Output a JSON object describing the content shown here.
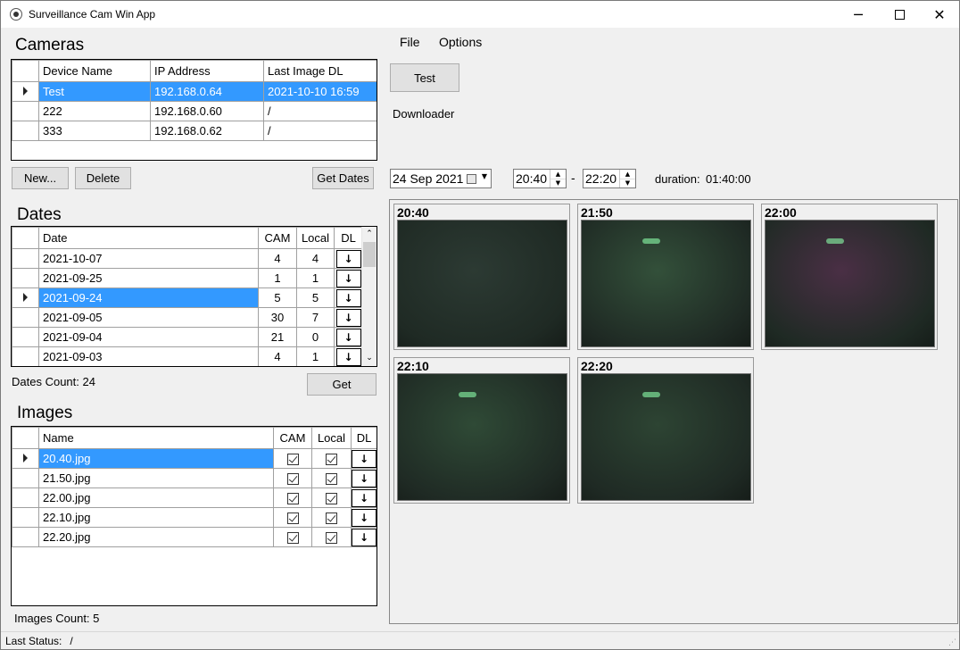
{
  "window": {
    "title": "Surveillance Cam Win App"
  },
  "menu": {
    "file": "File",
    "options": "Options"
  },
  "cameras": {
    "heading": "Cameras",
    "columns": [
      "Device Name",
      "IP Address",
      "Last Image DL"
    ],
    "rows": [
      {
        "name": "Test",
        "ip": "192.168.0.64",
        "last": "2021-10-10 16:59"
      },
      {
        "name": "222",
        "ip": "192.168.0.60",
        "last": "/"
      },
      {
        "name": "333",
        "ip": "192.168.0.62",
        "last": "/"
      }
    ],
    "selected_row": 0,
    "new_label": "New...",
    "delete_label": "Delete",
    "get_dates_label": "Get Dates"
  },
  "dates": {
    "heading": "Dates",
    "columns": [
      "Date",
      "CAM",
      "Local",
      "DL"
    ],
    "rows": [
      {
        "date": "2021-10-07",
        "cam": "4",
        "local": "4"
      },
      {
        "date": "2021-09-25",
        "cam": "1",
        "local": "1"
      },
      {
        "date": "2021-09-24",
        "cam": "5",
        "local": "5"
      },
      {
        "date": "2021-09-05",
        "cam": "30",
        "local": "7"
      },
      {
        "date": "2021-09-04",
        "cam": "21",
        "local": "0"
      },
      {
        "date": "2021-09-03",
        "cam": "4",
        "local": "1"
      }
    ],
    "selected_row": 2,
    "dl_glyph": "↓",
    "count_text": "Dates Count: 24",
    "get_label": "Get"
  },
  "images": {
    "heading": "Images",
    "columns": [
      "Name",
      "CAM",
      "Local",
      "DL"
    ],
    "rows": [
      {
        "name": "20.40.jpg"
      },
      {
        "name": "21.50.jpg"
      },
      {
        "name": "22.00.jpg"
      },
      {
        "name": "22.10.jpg"
      },
      {
        "name": "22.20.jpg"
      }
    ],
    "selected_row": 0,
    "count_text": "Images Count: 5"
  },
  "toolbar": {
    "test_label": "Test",
    "downloader_label": "Downloader"
  },
  "filter": {
    "date": "24 Sep 2021",
    "time_from": "20:40",
    "dash": "-",
    "time_to": "22:20",
    "duration_label": "duration:",
    "duration_value": "01:40:00"
  },
  "thumbnails": [
    {
      "time": "20:40",
      "tint": "#2c3a33"
    },
    {
      "time": "21:50",
      "tint": "#33503a"
    },
    {
      "time": "22:00",
      "tint": "#4a2f45"
    },
    {
      "time": "22:10",
      "tint": "#2f4a36"
    },
    {
      "time": "22:20",
      "tint": "#2d4433"
    }
  ],
  "status": {
    "label": "Last Status:",
    "value": "/"
  }
}
